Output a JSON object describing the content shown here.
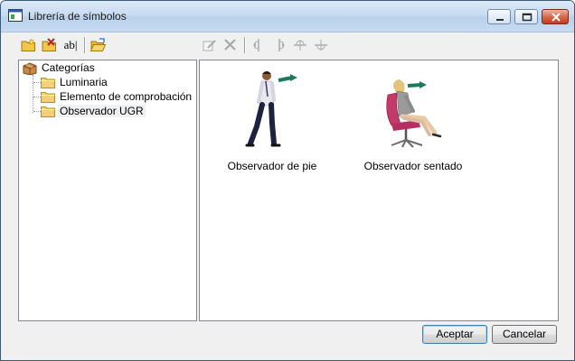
{
  "window": {
    "title": "Librería de símbolos"
  },
  "toolbar_left": [
    {
      "icon": "new-folder-icon"
    },
    {
      "icon": "delete-folder-icon"
    },
    {
      "icon": "rename-icon",
      "label": "ab|"
    },
    {
      "icon": "open-folder-icon"
    }
  ],
  "toolbar_right": [
    {
      "icon": "edit-icon"
    },
    {
      "icon": "delete-icon"
    },
    {
      "icon": "mirror-horizontal-icon"
    },
    {
      "icon": "mirror-horizontal-alt-icon"
    },
    {
      "icon": "rotate-icon"
    },
    {
      "icon": "rotate-alt-icon"
    }
  ],
  "tree": {
    "root": "Categorías",
    "children": [
      "Luminaria",
      "Elemento de comprobación",
      "Observador UGR"
    ],
    "selected_index": 2
  },
  "symbols": [
    {
      "caption": "Observador de pie"
    },
    {
      "caption": "Observador sentado"
    }
  ],
  "buttons": {
    "ok": "Aceptar",
    "cancel": "Cancelar"
  }
}
